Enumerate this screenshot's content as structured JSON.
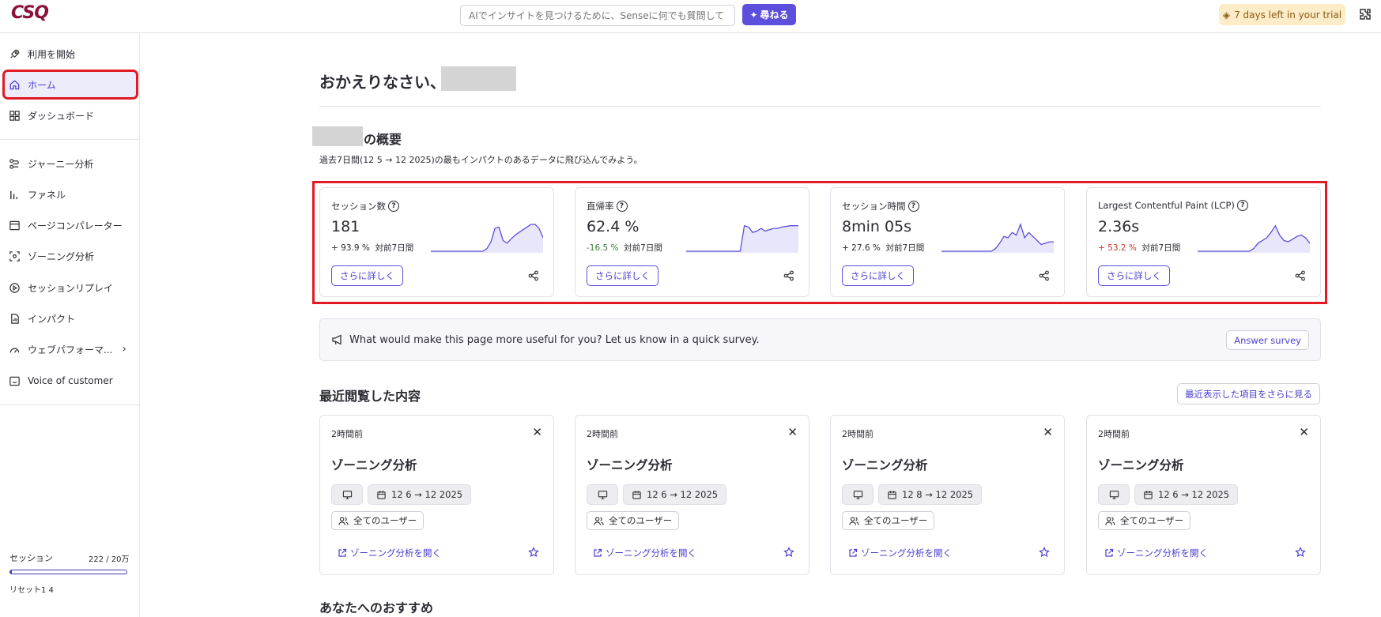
{
  "header": {
    "logo": "CSQ",
    "ask_placeholder": "AIでインサイトを見つけるために、Senseに何でも質問して",
    "ask_button": "尋ねる",
    "trial": "7 days left in your trial"
  },
  "sidebar": {
    "items": [
      {
        "label": "利用を開始",
        "icon": "rocket-icon"
      },
      {
        "label": "ホーム",
        "icon": "home-icon"
      },
      {
        "label": "ダッシュボード",
        "icon": "dashboard-icon"
      },
      {
        "label": "ジャーニー分析",
        "icon": "journey-icon"
      },
      {
        "label": "ファネル",
        "icon": "funnel-icon"
      },
      {
        "label": "ページコンパレーター",
        "icon": "page-icon"
      },
      {
        "label": "ゾーニング分析",
        "icon": "zoning-icon"
      },
      {
        "label": "セッションリプレイ",
        "icon": "play-icon"
      },
      {
        "label": "インパクト",
        "icon": "impact-icon"
      },
      {
        "label": "ウェブパフォーマ...",
        "icon": "gauge-icon"
      },
      {
        "label": "Voice of customer",
        "icon": "voc-icon"
      }
    ],
    "sessions": {
      "label": "セッション",
      "count": "222 / 20万",
      "fraction": 0.011,
      "reset": "リセット1 4"
    }
  },
  "main": {
    "greeting": "おかえりなさい、",
    "overview_title": "の概要",
    "overview_sub": "過去7日間(12 5 → 12 2025)の最もインパクトのあるデータに飛び込んでみよう。",
    "metrics": [
      {
        "title": "セッション数",
        "value": "181",
        "delta": "+ 93.9 %",
        "delta_tone": "normal",
        "period": "対前7日間",
        "more": "さらに詳しく",
        "spark": [
          0,
          0,
          0,
          0,
          0,
          0,
          0,
          0,
          0,
          0,
          0,
          0,
          0,
          0,
          0.1,
          0.35,
          0.85,
          0.9,
          0.4,
          0.3,
          0.45,
          0.6,
          0.7,
          0.8,
          0.9,
          1,
          1,
          0.85,
          0.5
        ]
      },
      {
        "title": "直帰率",
        "value": "62.4 %",
        "delta": "-16.5 %",
        "delta_tone": "neg",
        "period": "対前7日間",
        "more": "さらに詳しく",
        "spark": [
          0,
          0,
          0,
          0,
          0,
          0,
          0,
          0,
          0,
          0,
          0,
          0,
          0,
          0,
          0.95,
          0.9,
          0.7,
          0.75,
          0.85,
          0.75,
          0.8,
          0.85,
          0.85,
          0.9,
          0.92,
          0.95,
          0.95,
          0.95
        ]
      },
      {
        "title": "セッション時間",
        "value": "8min 05s",
        "delta": "+ 27.6 %",
        "delta_tone": "normal",
        "period": "対前7日間",
        "more": "さらに詳しく",
        "spark": [
          0,
          0,
          0,
          0,
          0,
          0,
          0,
          0,
          0,
          0,
          0,
          0,
          0,
          0.1,
          0.3,
          0.55,
          0.5,
          0.7,
          0.6,
          1,
          0.5,
          0.7,
          0.55,
          0.4,
          0.25,
          0.3,
          0.35,
          0.35
        ]
      },
      {
        "title": "Largest Contentful Paint (LCP)",
        "value": "2.36s",
        "delta": "+ 53.2 %",
        "delta_tone": "bad",
        "period": "対前7日間",
        "more": "さらに詳しく",
        "spark": [
          0,
          0,
          0,
          0,
          0,
          0,
          0,
          0,
          0,
          0,
          0,
          0,
          0,
          0.1,
          0.3,
          0.4,
          0.5,
          0.7,
          0.95,
          0.6,
          0.4,
          0.35,
          0.45,
          0.55,
          0.6,
          0.5,
          0.3
        ]
      }
    ],
    "survey": {
      "text": "What would make this page more useful for you? Let us know in a quick survey.",
      "button": "Answer survey"
    },
    "recent": {
      "title": "最近閲覧した内容",
      "more": "最近表示した項目をさらに見る",
      "cards": [
        {
          "time": "2時間前",
          "title": "ゾーニング分析",
          "date": "12 6 → 12 2025",
          "users": "全てのユーザー",
          "open": "ゾーニング分析を開く"
        },
        {
          "time": "2時間前",
          "title": "ゾーニング分析",
          "date": "12 6 → 12 2025",
          "users": "全てのユーザー",
          "open": "ゾーニング分析を開く"
        },
        {
          "time": "2時間前",
          "title": "ゾーニング分析",
          "date": "12 8 → 12 2025",
          "users": "全てのユーザー",
          "open": "ゾーニング分析を開く"
        },
        {
          "time": "2時間前",
          "title": "ゾーニング分析",
          "date": "12 6 → 12 2025",
          "users": "全てのユーザー",
          "open": "ゾーニング分析を開く"
        }
      ]
    },
    "recommend_title": "あなたへのおすすめ"
  },
  "colors": {
    "accent": "#5b4fdc",
    "highlight": "#e01b24",
    "logo": "#8a1238"
  }
}
